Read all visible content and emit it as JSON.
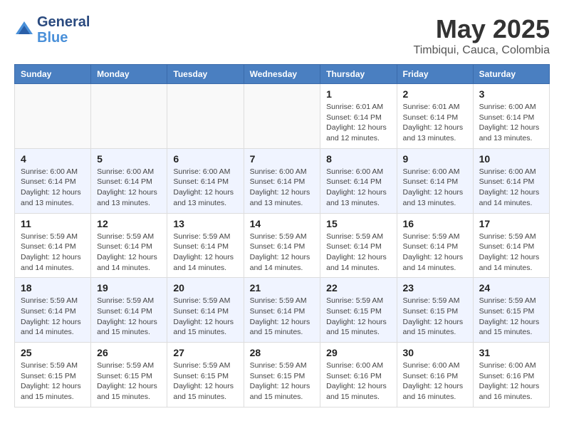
{
  "header": {
    "logo_line1": "General",
    "logo_line2": "Blue",
    "month_title": "May 2025",
    "subtitle": "Timbiqui, Cauca, Colombia"
  },
  "weekdays": [
    "Sunday",
    "Monday",
    "Tuesday",
    "Wednesday",
    "Thursday",
    "Friday",
    "Saturday"
  ],
  "weeks": [
    {
      "days": [
        {
          "num": "",
          "info": ""
        },
        {
          "num": "",
          "info": ""
        },
        {
          "num": "",
          "info": ""
        },
        {
          "num": "",
          "info": ""
        },
        {
          "num": "1",
          "info": "Sunrise: 6:01 AM\nSunset: 6:14 PM\nDaylight: 12 hours\nand 12 minutes."
        },
        {
          "num": "2",
          "info": "Sunrise: 6:01 AM\nSunset: 6:14 PM\nDaylight: 12 hours\nand 13 minutes."
        },
        {
          "num": "3",
          "info": "Sunrise: 6:00 AM\nSunset: 6:14 PM\nDaylight: 12 hours\nand 13 minutes."
        }
      ]
    },
    {
      "days": [
        {
          "num": "4",
          "info": "Sunrise: 6:00 AM\nSunset: 6:14 PM\nDaylight: 12 hours\nand 13 minutes."
        },
        {
          "num": "5",
          "info": "Sunrise: 6:00 AM\nSunset: 6:14 PM\nDaylight: 12 hours\nand 13 minutes."
        },
        {
          "num": "6",
          "info": "Sunrise: 6:00 AM\nSunset: 6:14 PM\nDaylight: 12 hours\nand 13 minutes."
        },
        {
          "num": "7",
          "info": "Sunrise: 6:00 AM\nSunset: 6:14 PM\nDaylight: 12 hours\nand 13 minutes."
        },
        {
          "num": "8",
          "info": "Sunrise: 6:00 AM\nSunset: 6:14 PM\nDaylight: 12 hours\nand 13 minutes."
        },
        {
          "num": "9",
          "info": "Sunrise: 6:00 AM\nSunset: 6:14 PM\nDaylight: 12 hours\nand 13 minutes."
        },
        {
          "num": "10",
          "info": "Sunrise: 6:00 AM\nSunset: 6:14 PM\nDaylight: 12 hours\nand 14 minutes."
        }
      ]
    },
    {
      "days": [
        {
          "num": "11",
          "info": "Sunrise: 5:59 AM\nSunset: 6:14 PM\nDaylight: 12 hours\nand 14 minutes."
        },
        {
          "num": "12",
          "info": "Sunrise: 5:59 AM\nSunset: 6:14 PM\nDaylight: 12 hours\nand 14 minutes."
        },
        {
          "num": "13",
          "info": "Sunrise: 5:59 AM\nSunset: 6:14 PM\nDaylight: 12 hours\nand 14 minutes."
        },
        {
          "num": "14",
          "info": "Sunrise: 5:59 AM\nSunset: 6:14 PM\nDaylight: 12 hours\nand 14 minutes."
        },
        {
          "num": "15",
          "info": "Sunrise: 5:59 AM\nSunset: 6:14 PM\nDaylight: 12 hours\nand 14 minutes."
        },
        {
          "num": "16",
          "info": "Sunrise: 5:59 AM\nSunset: 6:14 PM\nDaylight: 12 hours\nand 14 minutes."
        },
        {
          "num": "17",
          "info": "Sunrise: 5:59 AM\nSunset: 6:14 PM\nDaylight: 12 hours\nand 14 minutes."
        }
      ]
    },
    {
      "days": [
        {
          "num": "18",
          "info": "Sunrise: 5:59 AM\nSunset: 6:14 PM\nDaylight: 12 hours\nand 14 minutes."
        },
        {
          "num": "19",
          "info": "Sunrise: 5:59 AM\nSunset: 6:14 PM\nDaylight: 12 hours\nand 15 minutes."
        },
        {
          "num": "20",
          "info": "Sunrise: 5:59 AM\nSunset: 6:14 PM\nDaylight: 12 hours\nand 15 minutes."
        },
        {
          "num": "21",
          "info": "Sunrise: 5:59 AM\nSunset: 6:14 PM\nDaylight: 12 hours\nand 15 minutes."
        },
        {
          "num": "22",
          "info": "Sunrise: 5:59 AM\nSunset: 6:15 PM\nDaylight: 12 hours\nand 15 minutes."
        },
        {
          "num": "23",
          "info": "Sunrise: 5:59 AM\nSunset: 6:15 PM\nDaylight: 12 hours\nand 15 minutes."
        },
        {
          "num": "24",
          "info": "Sunrise: 5:59 AM\nSunset: 6:15 PM\nDaylight: 12 hours\nand 15 minutes."
        }
      ]
    },
    {
      "days": [
        {
          "num": "25",
          "info": "Sunrise: 5:59 AM\nSunset: 6:15 PM\nDaylight: 12 hours\nand 15 minutes."
        },
        {
          "num": "26",
          "info": "Sunrise: 5:59 AM\nSunset: 6:15 PM\nDaylight: 12 hours\nand 15 minutes."
        },
        {
          "num": "27",
          "info": "Sunrise: 5:59 AM\nSunset: 6:15 PM\nDaylight: 12 hours\nand 15 minutes."
        },
        {
          "num": "28",
          "info": "Sunrise: 5:59 AM\nSunset: 6:15 PM\nDaylight: 12 hours\nand 15 minutes."
        },
        {
          "num": "29",
          "info": "Sunrise: 6:00 AM\nSunset: 6:16 PM\nDaylight: 12 hours\nand 15 minutes."
        },
        {
          "num": "30",
          "info": "Sunrise: 6:00 AM\nSunset: 6:16 PM\nDaylight: 12 hours\nand 16 minutes."
        },
        {
          "num": "31",
          "info": "Sunrise: 6:00 AM\nSunset: 6:16 PM\nDaylight: 12 hours\nand 16 minutes."
        }
      ]
    }
  ]
}
